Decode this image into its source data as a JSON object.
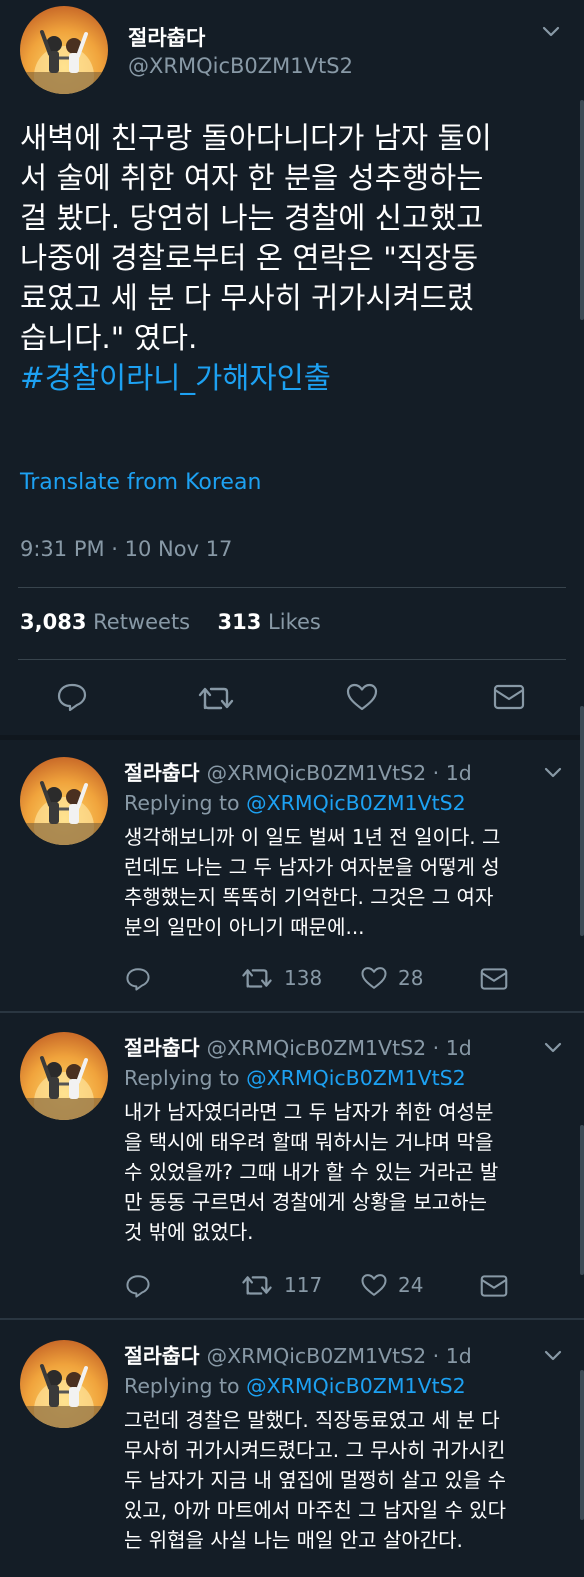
{
  "main_tweet": {
    "display_name": "절라춥다",
    "handle": "@XRMQicB0ZM1VtS2",
    "text_lines": [
      "새벽에 친구랑 돌아다니다가 남자 둘이",
      "서 술에 취한 여자 한 분을 성추행하는",
      "걸 봤다. 당연히 나는 경찰에 신고했고",
      "나중에 경찰로부터 온 연락은 \"직장동",
      "료였고 세 분 다 무사히 귀가시켜드렸",
      "습니다.\" 였다."
    ],
    "hashtag": "#경찰이라니_가해자인출",
    "translate_label": "Translate from Korean",
    "timestamp": "9:31 PM · 10 Nov 17",
    "retweets_count": "3,083",
    "retweets_label": "Retweets",
    "likes_count": "313",
    "likes_label": "Likes"
  },
  "replies": [
    {
      "display_name": "절라춥다",
      "meta": "@XRMQicB0ZM1VtS2 · 1d",
      "replying_prefix": "Replying to",
      "replying_handle": "@XRMQicB0ZM1VtS2",
      "lines": [
        "생각해보니까 이 일도 벌써 1년 전 일이다. 그",
        "런데도 나는 그 두 남자가 여자분을 어떻게 성",
        "추행했는지 똑똑히 기억한다. 그것은 그 여자",
        "분의 일만이 아니기 때문에..."
      ],
      "retweets": "138",
      "likes": "28"
    },
    {
      "display_name": "절라춥다",
      "meta": "@XRMQicB0ZM1VtS2 · 1d",
      "replying_prefix": "Replying to",
      "replying_handle": "@XRMQicB0ZM1VtS2",
      "lines": [
        "내가 남자였더라면 그 두 남자가 취한 여성분",
        "을 택시에 태우려 할때 뭐하시는 거냐며 막을",
        "수 있었을까? 그때 내가 할 수 있는 거라곤 발",
        "만 동동 구르면서 경찰에게 상황을 보고하는",
        "것 밖에 없었다."
      ],
      "retweets": "117",
      "likes": "24"
    },
    {
      "display_name": "절라춥다",
      "meta": "@XRMQicB0ZM1VtS2 · 1d",
      "replying_prefix": "Replying to",
      "replying_handle": "@XRMQicB0ZM1VtS2",
      "lines": [
        "그런데 경찰은 말했다. 직장동료였고 세 분 다",
        "무사히 귀가시켜드렸다고. 그 무사히 귀가시킨",
        "두 남자가 지금 내 옆집에 멀쩡히 살고 있을 수",
        "있고, 아까 마트에서 마주친 그 남자일 수 있다",
        "는 위협을 사실 나는 매일 안고 살아간다."
      ]
    }
  ],
  "colors": {
    "background": "#141d26",
    "accent": "#1da1f2",
    "muted": "#8899a6",
    "like": "#e0245e"
  }
}
